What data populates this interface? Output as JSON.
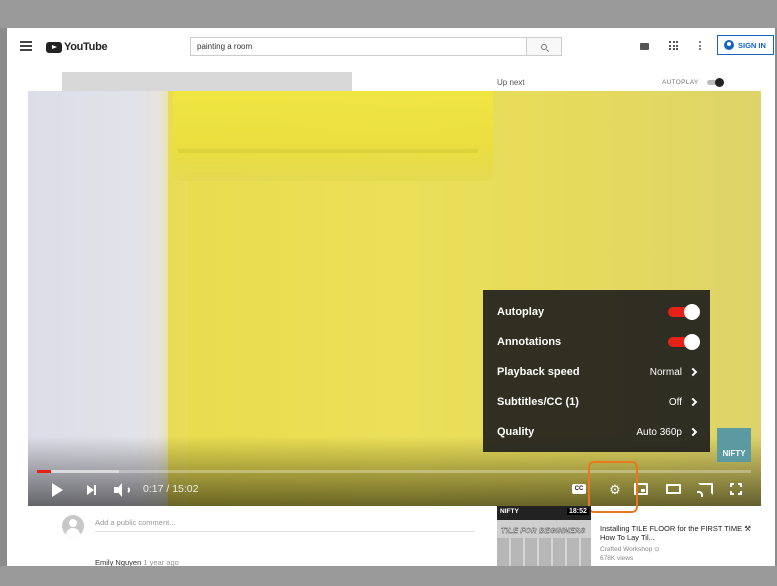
{
  "header": {
    "logo_text": "YouTube",
    "search_value": "painting a room",
    "signin_label": "SIGN IN"
  },
  "sidebar_next": {
    "up_next": "Up next",
    "autoplay_label": "AUTOPLAY",
    "autoplay_on": true
  },
  "player": {
    "time": "0:17 / 15:02",
    "progress_fraction": 0.019,
    "buffer_fraction": 0.115,
    "cc_label": "CC",
    "watermark": "NIFTY"
  },
  "settings_menu": {
    "items": [
      {
        "label": "Autoplay",
        "type": "toggle",
        "on": true
      },
      {
        "label": "Annotations",
        "type": "toggle",
        "on": true
      },
      {
        "label": "Playback speed",
        "type": "submenu",
        "value": "Normal"
      },
      {
        "label": "Subtitles/CC (1)",
        "type": "submenu",
        "value": "Off"
      },
      {
        "label": "Quality",
        "type": "submenu",
        "value": "Auto 360p"
      }
    ]
  },
  "comments": {
    "placeholder": "Add a public comment...",
    "first_author": "Emily Nguyen",
    "first_time": "1 year ago"
  },
  "recommendation": {
    "thumb_brand": "NIFTY",
    "thumb_duration": "18:52",
    "thumb_title": "TILE FOR BEGINNERS",
    "title": "Installing TILE FLOOR for the FIRST TIME ⚒ How To Lay Til...",
    "channel": "Crafted Workshop ⊙",
    "views": "678K views"
  },
  "colors": {
    "accent_red": "#e62117",
    "highlight_orange": "#e8781f",
    "signin_blue": "#1565c0",
    "paint_yellow": "#e8dc4e"
  },
  "icons": [
    "menu-icon",
    "search-icon",
    "video-camera-icon",
    "apps-grid-icon",
    "more-vert-icon",
    "account-icon",
    "play-icon",
    "next-icon",
    "volume-icon",
    "cc-icon",
    "gear-icon",
    "miniplayer-icon",
    "theater-icon",
    "cast-icon",
    "fullscreen-icon",
    "chevron-right-icon"
  ]
}
